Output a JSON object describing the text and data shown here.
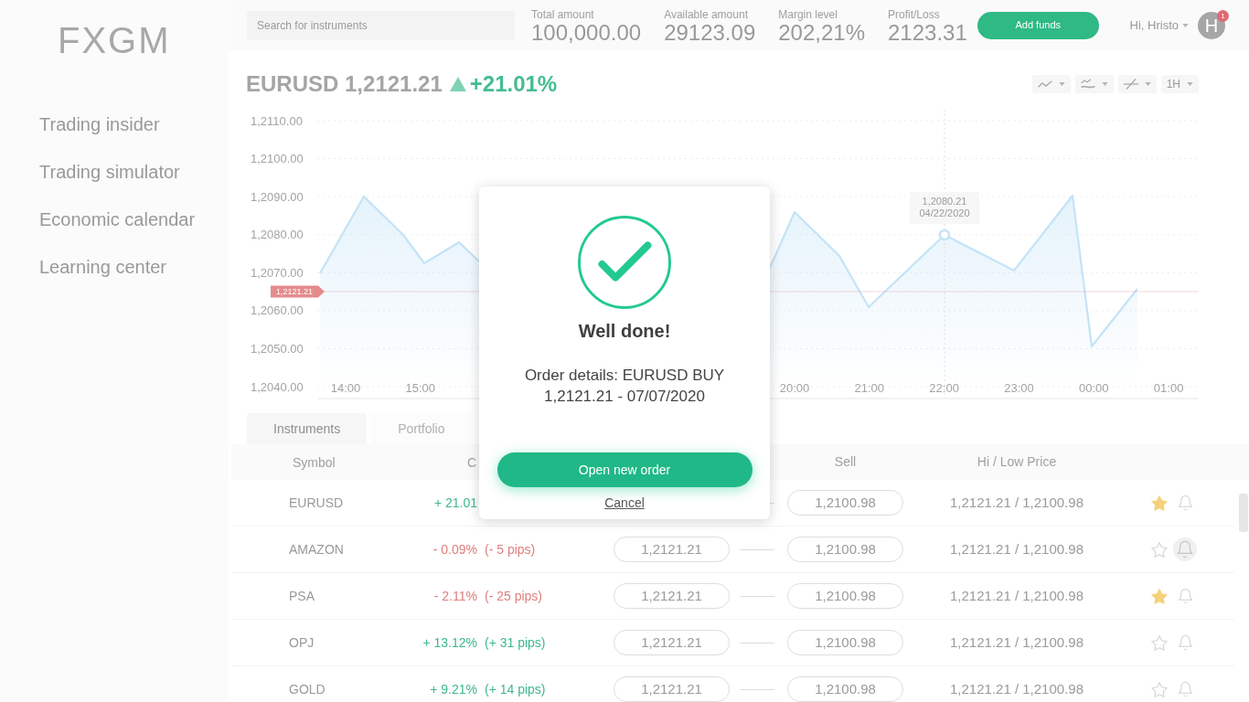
{
  "sidebar": {
    "logo": "FXGM",
    "items": [
      {
        "label": "Trading insider"
      },
      {
        "label": "Trading simulator"
      },
      {
        "label": "Economic calendar"
      },
      {
        "label": "Learning center"
      }
    ]
  },
  "top_bar": {
    "search": {
      "placeholder": "Search for instruments"
    },
    "stats": [
      {
        "label": "Total amount",
        "value": "100,000.00"
      },
      {
        "label": "Available amount",
        "value": "29123.09"
      },
      {
        "label": "Margin level",
        "value": "202,21%"
      },
      {
        "label": "Profit/Loss",
        "value": "2123.31"
      }
    ],
    "add_funds_button": "Add funds",
    "greeting": "Hi, Hristo",
    "avatar": "H",
    "notification_count": "1"
  },
  "instrument": {
    "title": "EURUSD 1,2121.21",
    "change": "+21.01%"
  },
  "chart_tools": [
    {
      "kind": "line"
    },
    {
      "kind": "indicators"
    },
    {
      "kind": "drawing"
    },
    {
      "kind": "interval",
      "label": "1H"
    }
  ],
  "chart": {
    "y_axis_labels": [
      "1,2110.00",
      "1,2100.00",
      "1,2090.00",
      "1,2080.00",
      "1,2070.00",
      "1,2060.00",
      "1,2050.00",
      "1,2040.00"
    ],
    "x_axis_labels": [
      "14:00",
      "15:00",
      "20:00",
      "21:00",
      "22:00",
      "23:00",
      "00:00",
      "01:00"
    ],
    "price_tag": "1,2121.21",
    "tooltip": [
      "1,2080.21",
      "04/22/2020"
    ]
  },
  "tabs": [
    {
      "label": "Instruments",
      "selected": true
    },
    {
      "label": "Portfolio",
      "selected": false
    }
  ],
  "table": {
    "columns": [
      {
        "label": "Symbol",
        "kind": "symbol"
      },
      {
        "label": "C",
        "kind": "change"
      },
      {
        "label": "Sell",
        "kind": "sell"
      },
      {
        "label": "Hi / Low Price",
        "kind": "range"
      }
    ],
    "rows": [
      {
        "symbol": "EURUSD",
        "kind": "gain",
        "change": "+ 21.01",
        "sell": "1,2100.98",
        "range": "1,2121.21 / 1,2100.98",
        "favorite": true,
        "alert": false
      },
      {
        "symbol": "AMAZON",
        "kind": "loss",
        "change": "- 0.09%",
        "pips": "(- 5 pips)",
        "buy": "1,2121.21",
        "sell": "1,2100.98",
        "range": "1,2121.21 / 1,2100.98",
        "favorite": false,
        "alert": true
      },
      {
        "symbol": "PSA",
        "kind": "loss",
        "change": "- 2.11%",
        "pips": "(- 25 pips)",
        "buy": "1,2121.21",
        "sell": "1,2100.98",
        "range": "1,2121.21 / 1,2100.98",
        "favorite": true,
        "alert": false
      },
      {
        "symbol": "OPJ",
        "kind": "gain",
        "change": "+ 13.12%",
        "pips": "(+ 31 pips)",
        "buy": "1,2121.21",
        "sell": "1,2100.98",
        "range": "1,2121.21 / 1,2100.98",
        "favorite": false,
        "alert": false
      },
      {
        "symbol": "GOLD",
        "kind": "gain",
        "change": "+ 9.21%",
        "pips": "(+ 14 pips)",
        "buy": "1,2121.21",
        "sell": "1,2100.98",
        "range": "1,2121.21 / 1,2100.98",
        "favorite": false,
        "alert": false
      }
    ]
  },
  "dialog": {
    "title": "Well done!",
    "details": "Order details: EURUSD BUY 1,2121.21 - 07/07/2020",
    "primary_button": "Open new order",
    "cancel_link": "Cancel"
  }
}
